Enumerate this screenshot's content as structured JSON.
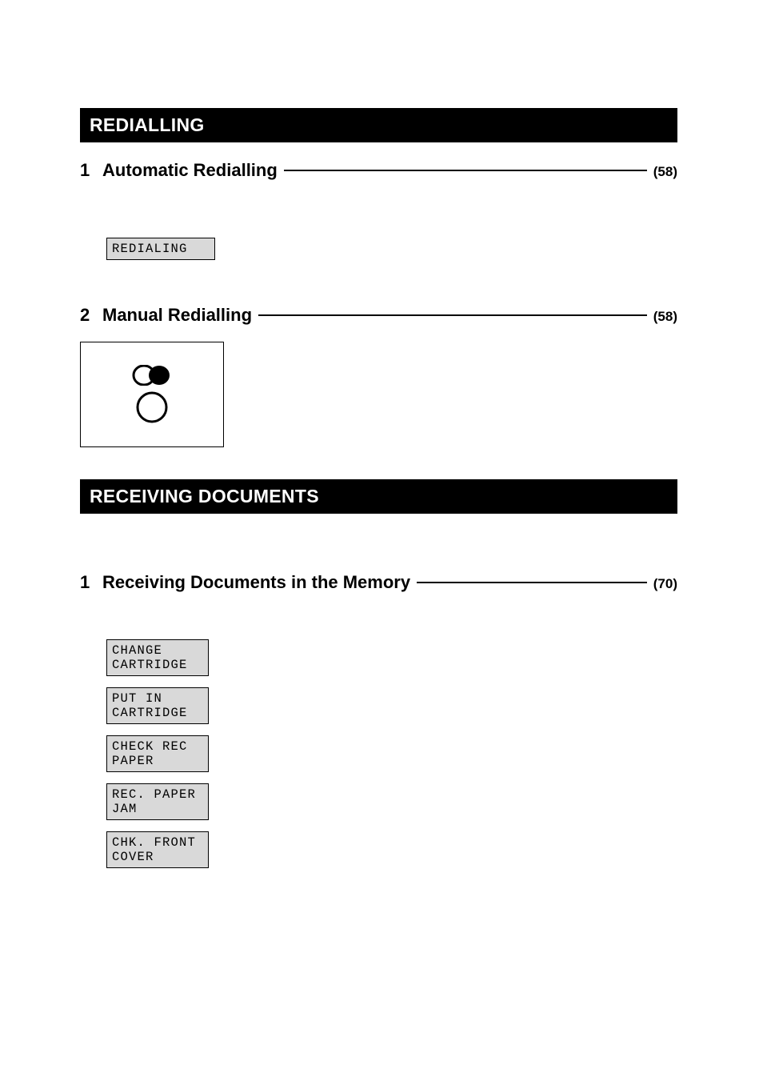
{
  "sections": {
    "redialling": {
      "header": "REDIALLING",
      "items": [
        {
          "num": "1",
          "title": "Automatic Redialling",
          "page": "(58)",
          "lcd": "REDIALING"
        },
        {
          "num": "2",
          "title": "Manual Redialling",
          "page": "(58)"
        }
      ]
    },
    "receiving": {
      "header": "RECEIVING DOCUMENTS",
      "items": [
        {
          "num": "1",
          "title": "Receiving Documents in the Memory",
          "page": "(70)",
          "lcds": [
            "CHANGE CARTRIDGE",
            "PUT IN CARTRIDGE",
            "CHECK REC PAPER",
            "REC. PAPER JAM",
            "CHK. FRONT COVER"
          ]
        }
      ]
    }
  }
}
